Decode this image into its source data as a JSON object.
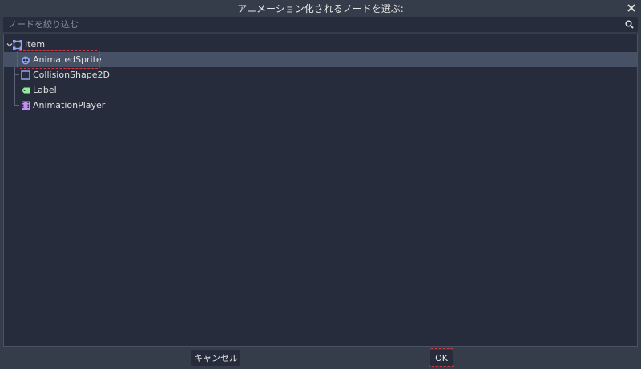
{
  "dialog": {
    "title": "アニメーション化されるノードを選ぶ:"
  },
  "search": {
    "placeholder": "ノードを絞り込む"
  },
  "tree": {
    "root": {
      "label": "Item",
      "icon": "node2d-icon",
      "color": "#8da5f3"
    },
    "children": [
      {
        "label": "AnimatedSprite",
        "icon": "animated-sprite-icon",
        "selected": true
      },
      {
        "label": "CollisionShape2D",
        "icon": "collision-shape-icon",
        "selected": false
      },
      {
        "label": "Label",
        "icon": "label-icon",
        "selected": false
      },
      {
        "label": "AnimationPlayer",
        "icon": "animation-player-icon",
        "selected": false
      }
    ]
  },
  "buttons": {
    "cancel": "キャンセル",
    "ok": "OK"
  },
  "colors": {
    "background": "#363d4a",
    "panel": "#262c3b",
    "selection": "#465165",
    "highlight": "#d9373f",
    "node_blue": "#8da5f3",
    "label_green": "#8eef97",
    "anim_purple": "#c38ef1"
  }
}
